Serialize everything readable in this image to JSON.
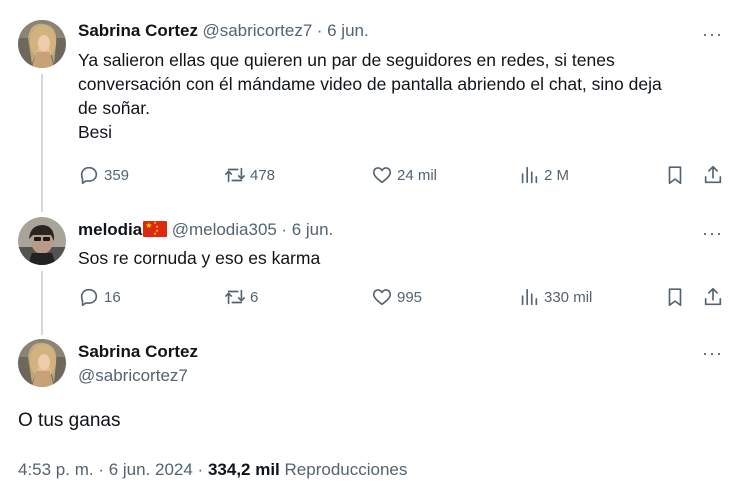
{
  "tweets": [
    {
      "display_name": "Sabrina Cortez",
      "handle": "@sabricortez7",
      "date": "· 6 jun.",
      "text_lines": [
        "Ya salieron ellas que quieren un par de seguidores en redes, si tenes",
        "conversación con él mándame video de pantalla abriendo el chat, sino deja",
        "de soñar.",
        "Besi"
      ],
      "replies": "359",
      "reposts": "478",
      "likes": "24 mil",
      "views": "2 M",
      "more": "···"
    },
    {
      "display_name": "melodia",
      "handle": "@melodia305",
      "date": "· 6 jun.",
      "text_lines": [
        "Sos re cornuda y eso es karma"
      ],
      "replies": "16",
      "reposts": "6",
      "likes": "995",
      "views": "330 mil",
      "more": "···"
    }
  ],
  "main": {
    "display_name": "Sabrina Cortez",
    "handle": "@sabricortez7",
    "text": "O tus ganas",
    "time": "4:53 p. m. · 6 jun. 2024 ·",
    "views_count": "334,2 mil",
    "views_label": "Reproducciones",
    "more": "···"
  },
  "icons": {
    "reply": "reply-icon",
    "repost": "repost-icon",
    "like": "heart-icon",
    "views": "views-icon",
    "bookmark": "bookmark-icon",
    "share": "share-icon",
    "flag": "china-flag-emoji"
  },
  "colors": {
    "text": "#0f1419",
    "muted": "#536471",
    "thread_line": "#cfd9de",
    "flag_red": "#de2910",
    "flag_yellow": "#ffde00"
  }
}
